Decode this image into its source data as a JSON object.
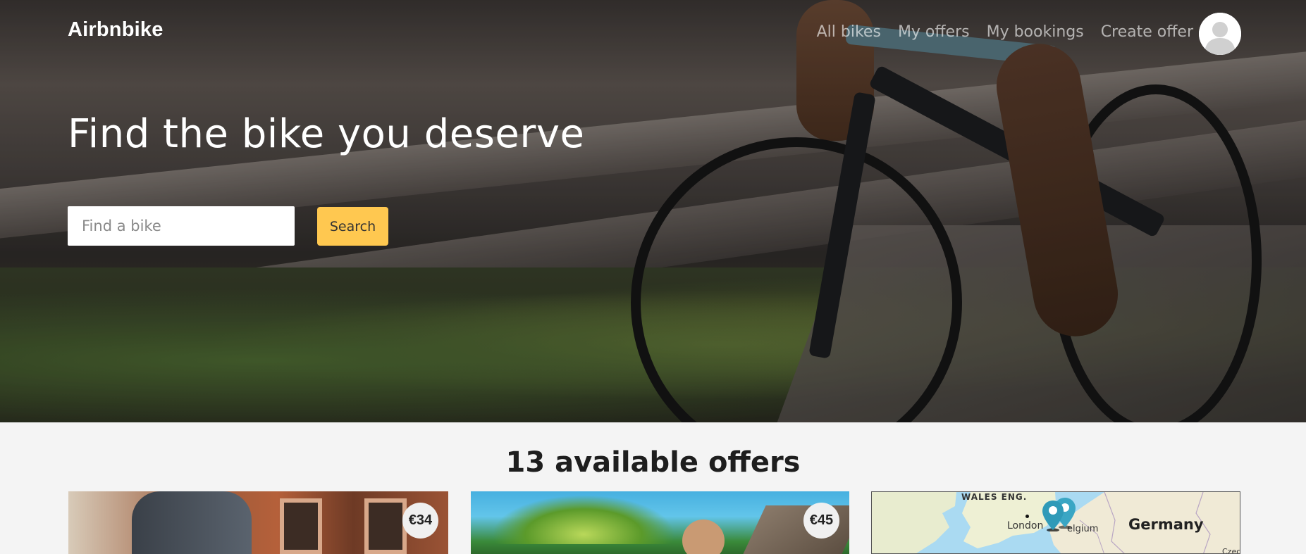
{
  "brand": {
    "name": "Airbnbike"
  },
  "nav": {
    "links": [
      {
        "label": "All bikes"
      },
      {
        "label": "My offers"
      },
      {
        "label": "My bookings"
      },
      {
        "label": "Create offer"
      }
    ],
    "avatar_icon": "user-avatar-icon"
  },
  "hero": {
    "title": "Find the bike you deserve",
    "search": {
      "placeholder": "Find a bike",
      "value": "",
      "button_label": "Search"
    }
  },
  "offers": {
    "title": "13 available offers",
    "cards": [
      {
        "price": "€34"
      },
      {
        "price": "€45"
      }
    ]
  },
  "map": {
    "labels": {
      "wales": "WALES",
      "england": "ENG.",
      "london": "London",
      "belgium": "elgium",
      "germany": "Germany",
      "czech": "Czech"
    },
    "pin_color": "#3aa6c4",
    "land_color": "#f0ead6",
    "sea_color": "#aadaf2"
  },
  "colors": {
    "accent": "#ffc850",
    "page_bg": "#f4f4f4"
  }
}
